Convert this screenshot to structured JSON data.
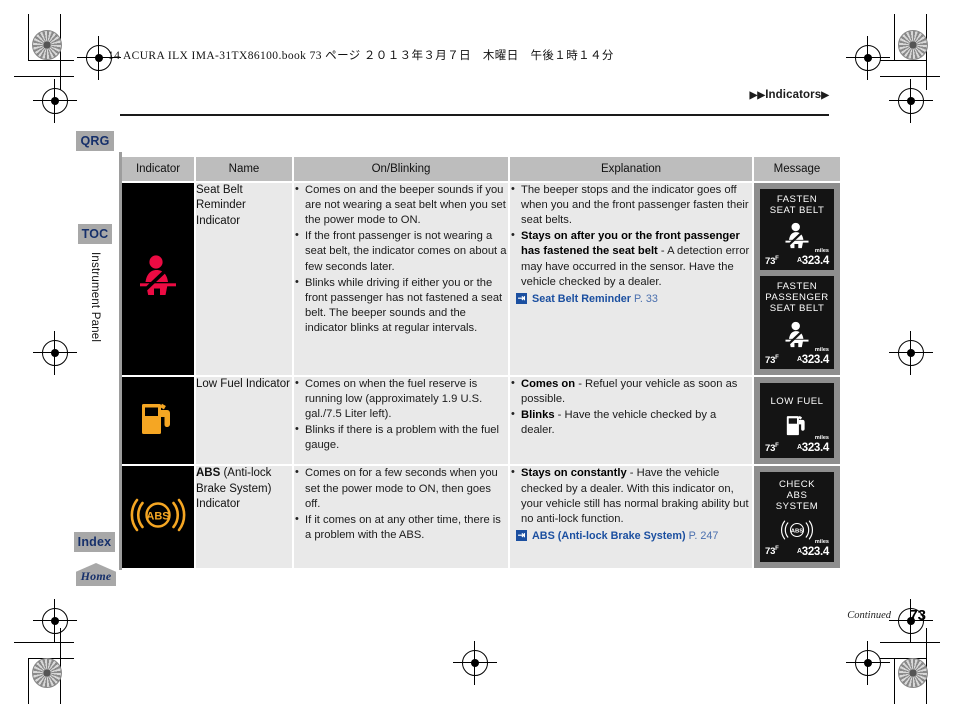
{
  "print_header": "14 ACURA ILX IMA-31TX86100.book  73 ページ  ２０１３年３月７日　木曜日　午後１時１４分",
  "running_header": "Indicators",
  "sidebar": {
    "tabs": [
      {
        "label": "QRG",
        "name": "qrg"
      },
      {
        "label": "TOC",
        "name": "toc"
      },
      {
        "label": "Index",
        "name": "index"
      },
      {
        "label": "Home",
        "name": "home"
      }
    ],
    "section_label": "Instrument Panel"
  },
  "table": {
    "headers": [
      "Indicator",
      "Name",
      "On/Blinking",
      "Explanation",
      "Message"
    ],
    "rows": [
      {
        "indicator_icon": "seat-belt-reminder-icon",
        "name_plain": "Seat Belt Reminder Indicator",
        "on_blinking": [
          "Comes on and the beeper sounds if you are not wearing a seat belt when you set the power mode to ON.",
          "If the front passenger is not wearing a seat belt, the indicator comes on about a few seconds later.",
          "Blinks while driving if either you or the front passenger has not fastened a seat belt. The beeper sounds and the indicator blinks at regular intervals."
        ],
        "explanation": [
          {
            "bold": "",
            "text": "The beeper stops and the indicator goes off when you and the front passenger fasten their seat belts."
          },
          {
            "bold": "Stays on after you or the front passenger has fastened the seat belt",
            "text": " - A detection error may have occurred in the sensor. Have the vehicle checked by a dealer."
          }
        ],
        "xref": {
          "name": "Seat Belt Reminder",
          "page": "P. 33"
        },
        "messages": [
          {
            "lines": [
              "FASTEN",
              "SEAT BELT"
            ],
            "icon": "seat-belt-display-icon",
            "temp": "73",
            "temp_unit": "F",
            "odo_prefix": "A",
            "odo": "323.4",
            "odo_unit": "miles"
          },
          {
            "lines": [
              "FASTEN",
              "PASSENGER",
              "SEAT BELT"
            ],
            "icon": "seat-belt-display-icon",
            "temp": "73",
            "temp_unit": "F",
            "odo_prefix": "A",
            "odo": "323.4",
            "odo_unit": "miles"
          }
        ]
      },
      {
        "indicator_icon": "low-fuel-icon",
        "name_plain": "Low Fuel Indicator",
        "on_blinking": [
          "Comes on when the fuel reserve is running low (approximately 1.9 U.S. gal./7.5 Liter left).",
          "Blinks if there is a problem with the fuel gauge."
        ],
        "explanation": [
          {
            "bold": "Comes on",
            "text": " - Refuel your vehicle as soon as possible."
          },
          {
            "bold": "Blinks",
            "text": " - Have the vehicle checked by a dealer."
          }
        ],
        "xref": null,
        "messages": [
          {
            "lines": [
              "LOW FUEL"
            ],
            "icon": "fuel-pump-display-icon",
            "temp": "73",
            "temp_unit": "F",
            "odo_prefix": "A",
            "odo": "323.4",
            "odo_unit": "miles"
          }
        ]
      },
      {
        "indicator_icon": "abs-icon",
        "name_bold": "ABS",
        "name_rest": " (Anti-lock Brake System) Indicator",
        "on_blinking": [
          "Comes on for a few seconds when you set the power mode to ON, then goes off.",
          "If it comes on at any other time, there is a problem with the ABS."
        ],
        "explanation": [
          {
            "bold": "Stays on constantly",
            "text": " - Have the vehicle checked by a dealer. With this indicator on, your vehicle still has normal braking ability but no anti-lock function."
          }
        ],
        "xref": {
          "name": "ABS (Anti-lock Brake System)",
          "page": "P. 247"
        },
        "messages": [
          {
            "lines": [
              "CHECK",
              "ABS",
              "SYSTEM"
            ],
            "icon": "abs-display-icon",
            "temp": "73",
            "temp_unit": "F",
            "odo_prefix": "A",
            "odo": "323.4",
            "odo_unit": "miles"
          }
        ]
      }
    ]
  },
  "footer": {
    "continued": "Continued",
    "page_number": "73"
  },
  "colors": {
    "seat_belt_red": "#ec0b43",
    "fuel_amber": "#f5a623",
    "abs_amber": "#f5a623",
    "link_blue": "#1b4fa0",
    "tab_gray": "#a8a8a8"
  }
}
